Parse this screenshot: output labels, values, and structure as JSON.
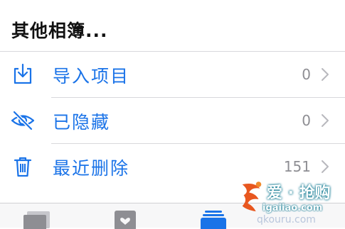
{
  "section": {
    "title": "其他相簿..."
  },
  "rows": [
    {
      "label": "导入项目",
      "count": "0",
      "icon": "import-icon"
    },
    {
      "label": "已隐藏",
      "count": "0",
      "icon": "hidden-eye-icon"
    },
    {
      "label": "最近删除",
      "count": "151",
      "icon": "trash-icon"
    }
  ],
  "tabbar": {
    "icons": [
      "library-photos-icon",
      "for-you-icon",
      "albums-icon"
    ]
  },
  "watermark": {
    "text": "爱 · 抢购",
    "url": "igaiiao.com",
    "under": "qkouru.com"
  },
  "colors": {
    "accent": "#1a73e8",
    "count": "#8e8e93",
    "divider": "#d8d8dc"
  }
}
